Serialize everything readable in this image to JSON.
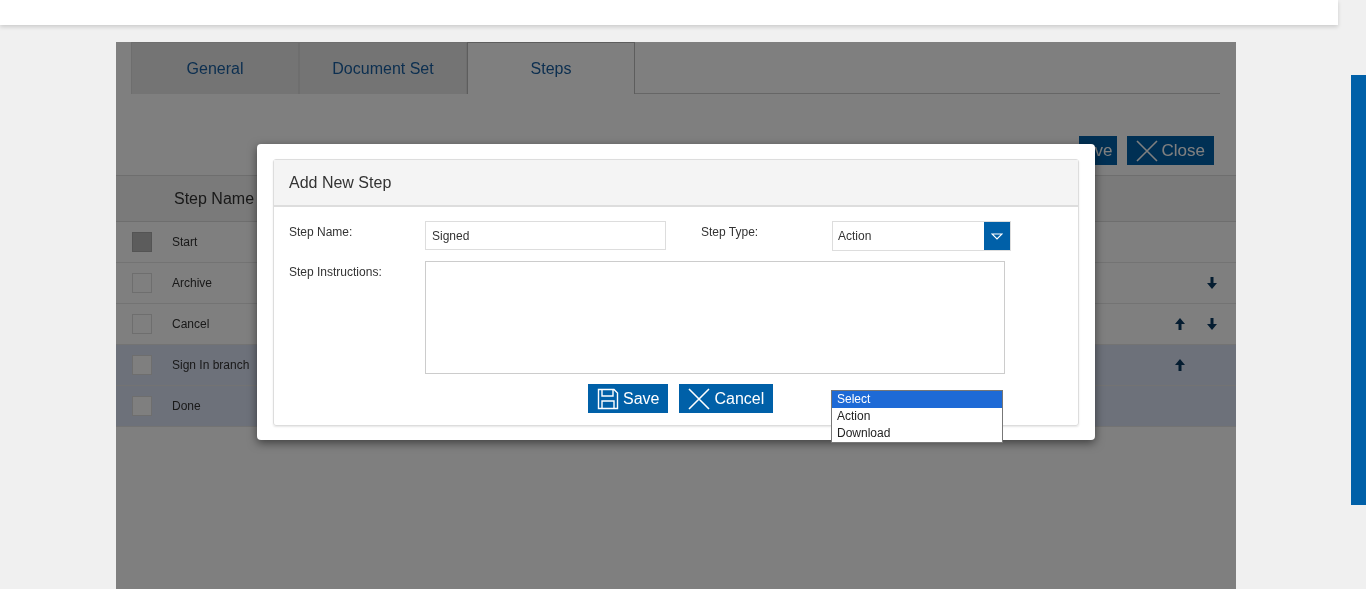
{
  "tabs": [
    {
      "label": "General",
      "selected": false
    },
    {
      "label": "Document Set",
      "selected": false
    },
    {
      "label": "Steps",
      "selected": true
    }
  ],
  "toolbar": {
    "save_label": "ve",
    "close_label": "Close"
  },
  "table": {
    "columns": [
      "Step Name"
    ],
    "rows": [
      {
        "name": "Start",
        "selected": false,
        "disabled": true,
        "move_up": false,
        "move_down": false
      },
      {
        "name": "Archive",
        "selected": false,
        "disabled": false,
        "move_up": false,
        "move_down": true
      },
      {
        "name": "Cancel",
        "selected": false,
        "disabled": false,
        "move_up": true,
        "move_down": true
      },
      {
        "name": "Sign In branch",
        "selected": true,
        "disabled": false,
        "move_up": true,
        "move_down": false
      },
      {
        "name": "Done",
        "selected": true,
        "disabled": false,
        "move_up": false,
        "move_down": false
      }
    ]
  },
  "dialog": {
    "title": "Add New Step",
    "step_name_label": "Step Name:",
    "step_name_value": "Signed",
    "step_type_label": "Step Type:",
    "step_type_value": "Action",
    "instructions_label": "Step Instructions:",
    "save_label": "Save",
    "cancel_label": "Cancel",
    "dropdown_options": [
      {
        "label": "Select",
        "selected": true
      },
      {
        "label": "Action",
        "selected": false
      },
      {
        "label": "Download",
        "selected": false
      }
    ]
  }
}
